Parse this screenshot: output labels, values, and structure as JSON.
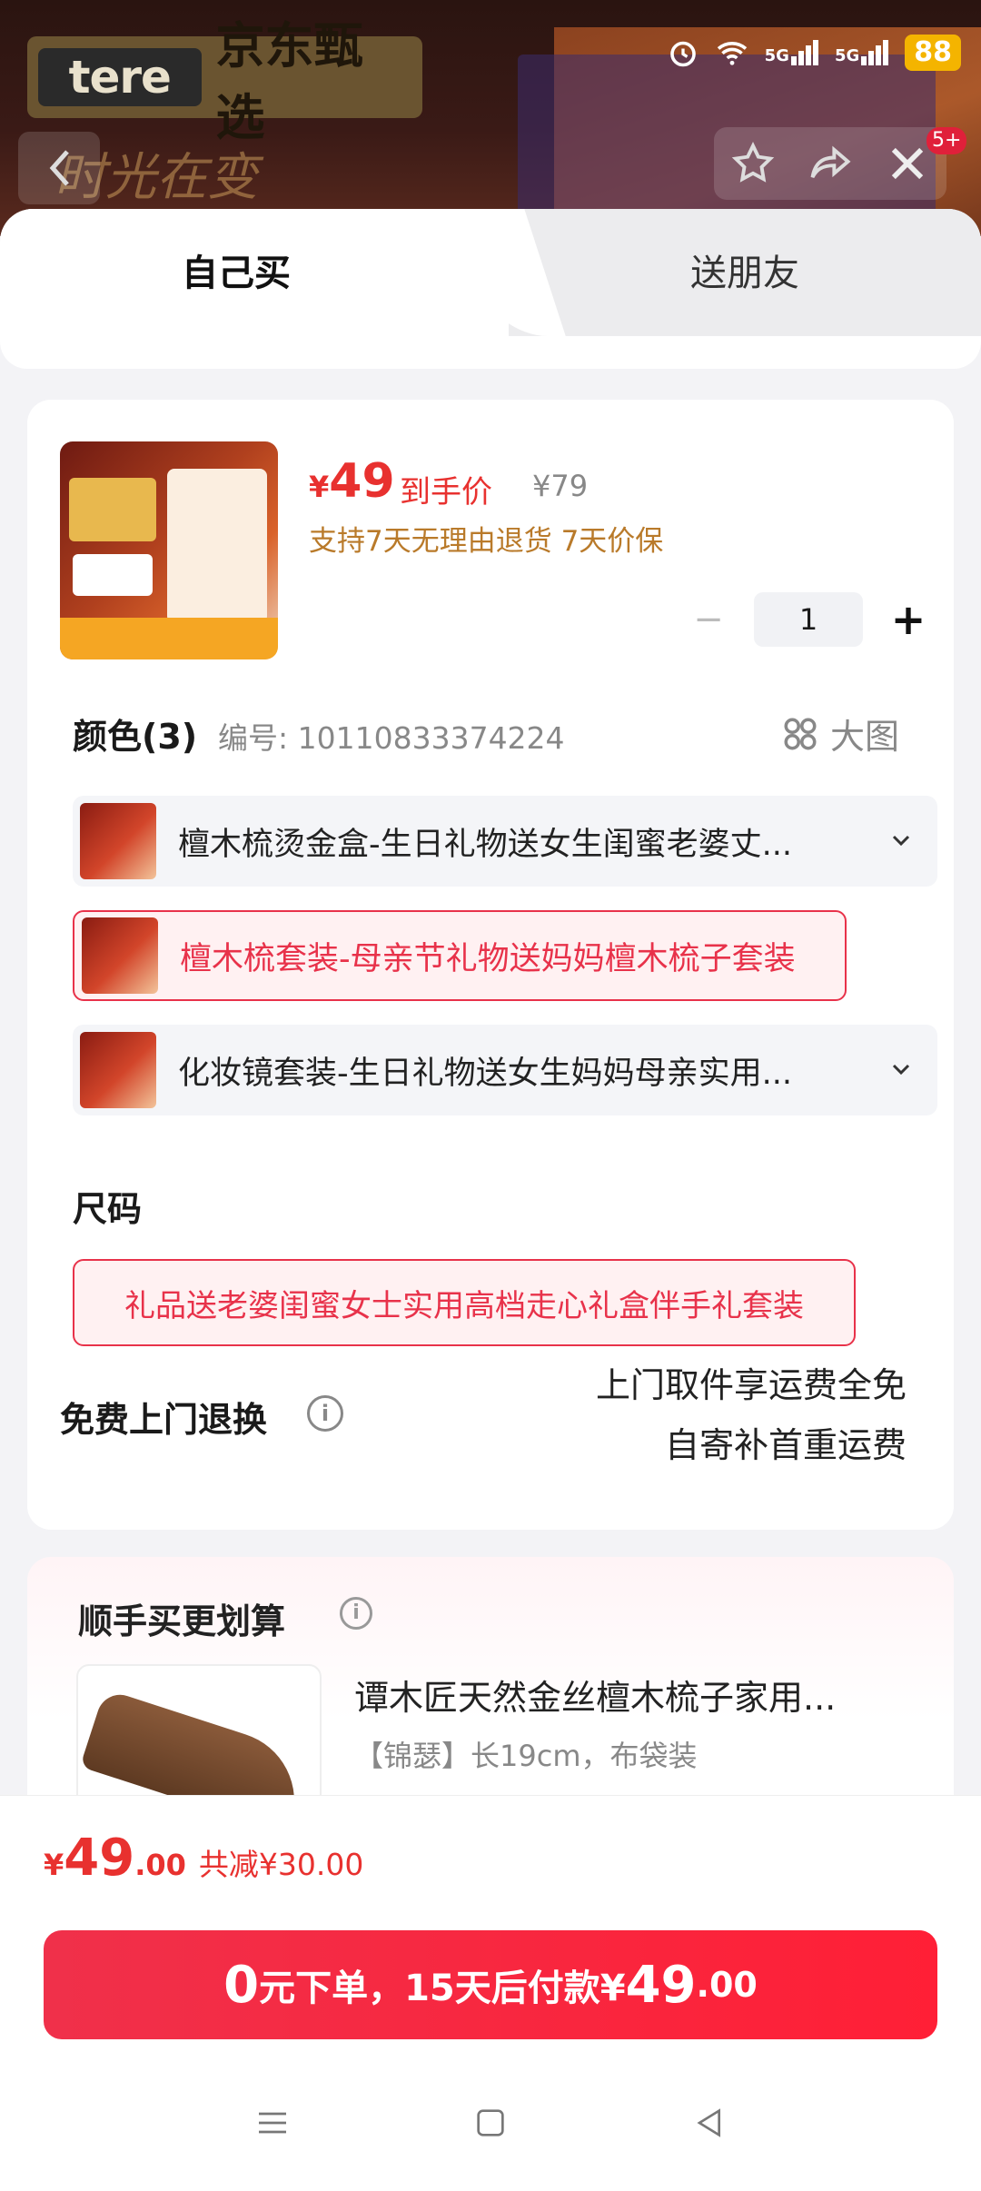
{
  "background": {
    "brand_name": "京东甄选",
    "brand_mark": "tere",
    "calligraphy": "时光在变"
  },
  "statusbar": {
    "battery": "88",
    "network1": "5G",
    "network2": "5G"
  },
  "nav": {
    "badge": "5+"
  },
  "tabs": [
    {
      "label": "自己买",
      "active": true
    },
    {
      "label": "送朋友",
      "active": false
    }
  ],
  "product": {
    "price_currency": "¥",
    "price": "49",
    "price_label": "到手价",
    "original_price": "¥79",
    "promise": "支持7天无理由退货 7天价保",
    "quantity": "1",
    "minus_label": "−",
    "plus_label": "+"
  },
  "color": {
    "title": "颜色(3)",
    "code": "编号: 10110833374224",
    "big_pic_label": "大图",
    "options": [
      {
        "label": "檀木梳烫金盒-生日礼物送女生闺蜜老婆丈...",
        "selected": false
      },
      {
        "label": "檀木梳套装-母亲节礼物送妈妈檀木梳子套装",
        "selected": true
      },
      {
        "label": "化妆镜套装-生日礼物送女生妈妈母亲实用...",
        "selected": false
      }
    ]
  },
  "size": {
    "title": "尺码",
    "selected": "礼品送老婆闺蜜女士实用高档走心礼盒伴手礼套装"
  },
  "returns": {
    "title": "免费上门退换",
    "line1": "上门取件享运费全免",
    "line2": "自寄补首重运费"
  },
  "addon": {
    "title": "顺手买更划算",
    "item_name": "谭木匠天然金丝檀木梳子家用...",
    "item_spec": "【锦瑟】长19cm，布袋装"
  },
  "footer": {
    "currency": "¥",
    "total_int": "49",
    "total_dec": ".00",
    "savings": "共减¥30.00",
    "pay_zero": "0",
    "pay_text": "元下单，15天后付款¥",
    "pay_int": "49",
    "pay_dec": ".00"
  },
  "colors": {
    "accent": "#e8312f",
    "select_border": "#e8324a",
    "promise": "#b97a2a"
  }
}
